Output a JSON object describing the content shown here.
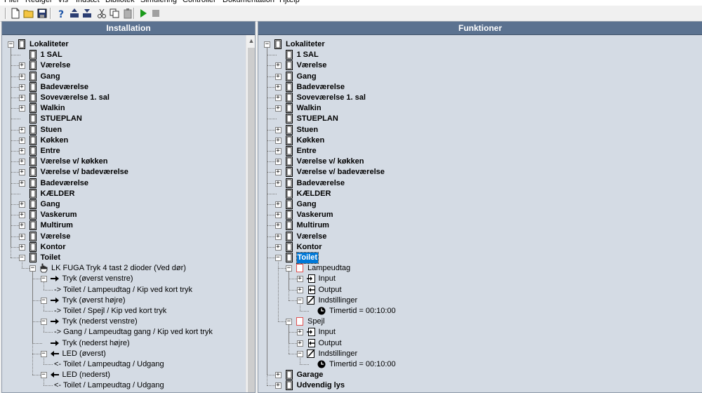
{
  "menu": {
    "items": [
      "Filer",
      "Rediger",
      "Vis",
      "Indsæt",
      "Bibliotek",
      "Simulering",
      "Controller",
      "Dokumentation",
      "Hjælp"
    ]
  },
  "toolbar": {
    "buttons": [
      "new-file-icon",
      "open-folder-icon",
      "save-disk-icon",
      "help-icon",
      "upload-icon",
      "download-icon",
      "cut-icon",
      "copy-icon",
      "paste-icon",
      "run-icon",
      "stop-icon"
    ]
  },
  "installation": {
    "header": "Installation",
    "rows": [
      {
        "text": "Lokaliteter",
        "level": 0,
        "icon": "device-icon",
        "expander": "minus",
        "bold": true
      },
      {
        "text": "1 SAL",
        "level": 1,
        "icon": "device-icon",
        "expander": "none",
        "bold": true
      },
      {
        "text": "Værelse",
        "level": 1,
        "icon": "device-icon",
        "expander": "plus",
        "bold": true
      },
      {
        "text": "Gang",
        "level": 1,
        "icon": "device-icon",
        "expander": "plus",
        "bold": true
      },
      {
        "text": "Badeværelse",
        "level": 1,
        "icon": "device-icon",
        "expander": "plus",
        "bold": true
      },
      {
        "text": "Soveværelse 1. sal",
        "level": 1,
        "icon": "device-icon",
        "expander": "plus",
        "bold": true
      },
      {
        "text": "Walkin",
        "level": 1,
        "icon": "device-icon",
        "expander": "plus",
        "bold": true
      },
      {
        "text": "STUEPLAN",
        "level": 1,
        "icon": "device-icon",
        "expander": "none",
        "bold": true
      },
      {
        "text": "Stuen",
        "level": 1,
        "icon": "device-icon",
        "expander": "plus",
        "bold": true
      },
      {
        "text": "Køkken",
        "level": 1,
        "icon": "device-icon",
        "expander": "plus",
        "bold": true
      },
      {
        "text": "Entre",
        "level": 1,
        "icon": "device-icon",
        "expander": "plus",
        "bold": true
      },
      {
        "text": "Værelse v/ køkken",
        "level": 1,
        "icon": "device-icon",
        "expander": "plus",
        "bold": true
      },
      {
        "text": "Værelse v/ badeværelse",
        "level": 1,
        "icon": "device-icon",
        "expander": "plus",
        "bold": true
      },
      {
        "text": "Badeværelse",
        "level": 1,
        "icon": "device-icon",
        "expander": "plus",
        "bold": true
      },
      {
        "text": "KÆLDER",
        "level": 1,
        "icon": "device-icon",
        "expander": "none",
        "bold": true
      },
      {
        "text": "Gang",
        "level": 1,
        "icon": "device-icon",
        "expander": "plus",
        "bold": true
      },
      {
        "text": "Vaskerum",
        "level": 1,
        "icon": "device-icon",
        "expander": "plus",
        "bold": true
      },
      {
        "text": "Multirum",
        "level": 1,
        "icon": "device-icon",
        "expander": "plus",
        "bold": true
      },
      {
        "text": "Værelse",
        "level": 1,
        "icon": "device-icon",
        "expander": "plus",
        "bold": true
      },
      {
        "text": "Kontor",
        "level": 1,
        "icon": "device-icon",
        "expander": "plus",
        "bold": true
      },
      {
        "text": "Toilet",
        "level": 1,
        "icon": "device-icon",
        "expander": "minus",
        "bold": true
      },
      {
        "text": "LK FUGA Tryk 4 tast 2 dioder (Ved dør)",
        "level": 2,
        "icon": "hand-pointer-icon",
        "expander": "minus",
        "bold": false
      },
      {
        "text": "Tryk (øverst venstre)",
        "level": 3,
        "icon": "arrow-right-icon",
        "expander": "minus",
        "bold": false
      },
      {
        "text": "-> Toilet / Lampeudtag / Kip ved kort tryk",
        "level": 4,
        "icon": "",
        "expander": "none",
        "bold": false
      },
      {
        "text": "Tryk (øverst højre)",
        "level": 3,
        "icon": "arrow-right-icon",
        "expander": "minus",
        "bold": false
      },
      {
        "text": "-> Toilet / Spejl / Kip ved kort tryk",
        "level": 4,
        "icon": "",
        "expander": "none",
        "bold": false
      },
      {
        "text": "Tryk (nederst venstre)",
        "level": 3,
        "icon": "arrow-right-icon",
        "expander": "minus",
        "bold": false
      },
      {
        "text": "-> Gang / Lampeudtag gang / Kip ved kort tryk",
        "level": 4,
        "icon": "",
        "expander": "none",
        "bold": false
      },
      {
        "text": "Tryk (nederst højre)",
        "level": 3,
        "icon": "arrow-right-icon",
        "expander": "none",
        "bold": false
      },
      {
        "text": "LED (øverst)",
        "level": 3,
        "icon": "arrow-left-icon",
        "expander": "minus",
        "bold": false
      },
      {
        "text": "<- Toilet / Lampeudtag / Udgang",
        "level": 4,
        "icon": "",
        "expander": "none",
        "bold": false
      },
      {
        "text": "LED (nederst)",
        "level": 3,
        "icon": "arrow-left-icon",
        "expander": "minus",
        "bold": false
      },
      {
        "text": "<- Toilet / Lampeudtag / Udgang",
        "level": 4,
        "icon": "",
        "expander": "none",
        "bold": false
      }
    ]
  },
  "funktioner": {
    "header": "Funktioner",
    "rows": [
      {
        "text": "Lokaliteter",
        "level": 0,
        "icon": "device-icon",
        "expander": "minus",
        "bold": true
      },
      {
        "text": "1 SAL",
        "level": 1,
        "icon": "device-icon",
        "expander": "none",
        "bold": true
      },
      {
        "text": "Værelse",
        "level": 1,
        "icon": "device-icon",
        "expander": "plus",
        "bold": true
      },
      {
        "text": "Gang",
        "level": 1,
        "icon": "device-icon",
        "expander": "plus",
        "bold": true
      },
      {
        "text": "Badeværelse",
        "level": 1,
        "icon": "device-icon",
        "expander": "plus",
        "bold": true
      },
      {
        "text": "Soveværelse 1. sal",
        "level": 1,
        "icon": "device-icon",
        "expander": "plus",
        "bold": true
      },
      {
        "text": "Walkin",
        "level": 1,
        "icon": "device-icon",
        "expander": "plus",
        "bold": true
      },
      {
        "text": "STUEPLAN",
        "level": 1,
        "icon": "device-icon",
        "expander": "none",
        "bold": true
      },
      {
        "text": "Stuen",
        "level": 1,
        "icon": "device-icon",
        "expander": "plus",
        "bold": true
      },
      {
        "text": "Køkken",
        "level": 1,
        "icon": "device-icon",
        "expander": "plus",
        "bold": true
      },
      {
        "text": "Entre",
        "level": 1,
        "icon": "device-icon",
        "expander": "plus",
        "bold": true
      },
      {
        "text": "Værelse v/ køkken",
        "level": 1,
        "icon": "device-icon",
        "expander": "plus",
        "bold": true
      },
      {
        "text": "Værelse v/ badeværelse",
        "level": 1,
        "icon": "device-icon",
        "expander": "plus",
        "bold": true
      },
      {
        "text": "Badeværelse",
        "level": 1,
        "icon": "device-icon",
        "expander": "plus",
        "bold": true
      },
      {
        "text": "KÆLDER",
        "level": 1,
        "icon": "device-icon",
        "expander": "none",
        "bold": true
      },
      {
        "text": "Gang",
        "level": 1,
        "icon": "device-icon",
        "expander": "plus",
        "bold": true
      },
      {
        "text": "Vaskerum",
        "level": 1,
        "icon": "device-icon",
        "expander": "plus",
        "bold": true
      },
      {
        "text": "Multirum",
        "level": 1,
        "icon": "device-icon",
        "expander": "plus",
        "bold": true
      },
      {
        "text": "Værelse",
        "level": 1,
        "icon": "device-icon",
        "expander": "plus",
        "bold": true
      },
      {
        "text": "Kontor",
        "level": 1,
        "icon": "device-icon",
        "expander": "plus",
        "bold": true
      },
      {
        "text": "Toilet",
        "level": 1,
        "icon": "device-icon",
        "expander": "minus",
        "bold": true,
        "selected": true
      },
      {
        "text": "Lampeudtag",
        "level": 2,
        "icon": "function-box-icon",
        "expander": "minus",
        "bold": false
      },
      {
        "text": "Input",
        "level": 3,
        "icon": "input-icon",
        "expander": "plus",
        "bold": false
      },
      {
        "text": "Output",
        "level": 3,
        "icon": "output-icon",
        "expander": "plus",
        "bold": false
      },
      {
        "text": "Indstillinger",
        "level": 3,
        "icon": "settings-icon",
        "expander": "minus",
        "bold": false
      },
      {
        "text": "Timertid = 00:10:00",
        "level": 4,
        "icon": "clock-icon",
        "expander": "none",
        "bold": false
      },
      {
        "text": "Spejl",
        "level": 2,
        "icon": "function-box-icon",
        "expander": "minus",
        "bold": false
      },
      {
        "text": "Input",
        "level": 3,
        "icon": "input-icon",
        "expander": "plus",
        "bold": false
      },
      {
        "text": "Output",
        "level": 3,
        "icon": "output-icon",
        "expander": "plus",
        "bold": false
      },
      {
        "text": "Indstillinger",
        "level": 3,
        "icon": "settings-icon",
        "expander": "minus",
        "bold": false
      },
      {
        "text": "Timertid = 00:10:00",
        "level": 4,
        "icon": "clock-icon",
        "expander": "none",
        "bold": false
      },
      {
        "text": "Garage",
        "level": 1,
        "icon": "device-icon",
        "expander": "plus",
        "bold": true
      },
      {
        "text": "Udvendig lys",
        "level": 1,
        "icon": "device-icon",
        "expander": "plus",
        "bold": true
      }
    ]
  },
  "colors": {
    "pane_header": "#5b7290",
    "tree_background": "#d4dbe4",
    "selection": "#0078d7",
    "function_box": "#e05050"
  }
}
